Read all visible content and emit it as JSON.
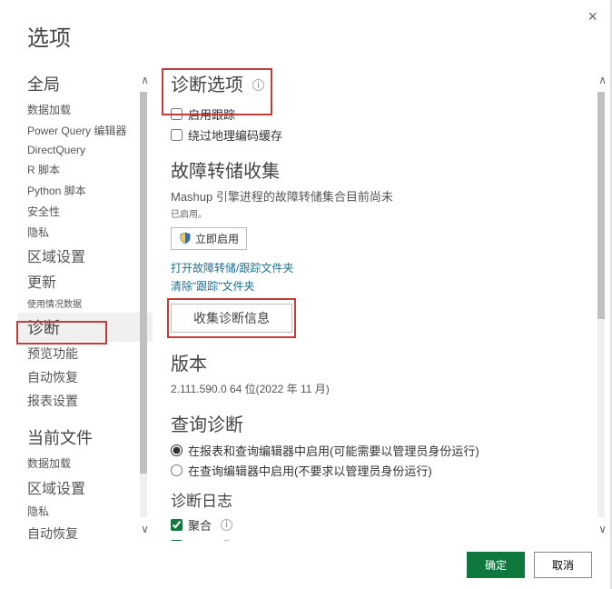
{
  "dialog": {
    "title": "选项"
  },
  "sidebar": {
    "sectionA": "全局",
    "items": [
      "数据加载",
      "Power Query 编辑器",
      "DirectQuery",
      "R 脚本",
      "Python 脚本",
      "安全性",
      "隐私",
      "区域设置",
      "更新",
      "使用情况数据",
      "诊断",
      "预览功能",
      "自动恢复",
      "报表设置"
    ],
    "sectionB": "当前文件",
    "itemsB": [
      "数据加载",
      "区域设置",
      "隐私",
      "自动恢复"
    ]
  },
  "content": {
    "diag_title": "诊断选项",
    "enable_trace": "启用跟踪",
    "bypass_geo": "绕过地理编码缓存",
    "crash_title": "故障转储收集",
    "crash_text": "Mashup 引擎进程的故障转储集合目前尚未",
    "crash_sub": "已启用。",
    "enable_now": "立即启用",
    "link_open": "打开故障转储/跟踪文件夹",
    "link_clear": "清除\"跟踪\"文件夹",
    "collect": "收集诊断信息",
    "ver_title": "版本",
    "ver_text": "2.111.590.0 64 位(2022 年 11 月)",
    "qd_title": "查询诊断",
    "qd_r1": "在报表和查询编辑器中启用(可能需要以管理员身份运行)",
    "qd_r2": "在查询编辑器中启用(不要求以管理员身份运行)",
    "dl_title": "诊断日志",
    "dl_c1": "聚合",
    "dl_c2": "详细"
  },
  "footer": {
    "ok": "确定",
    "cancel": "取消"
  }
}
